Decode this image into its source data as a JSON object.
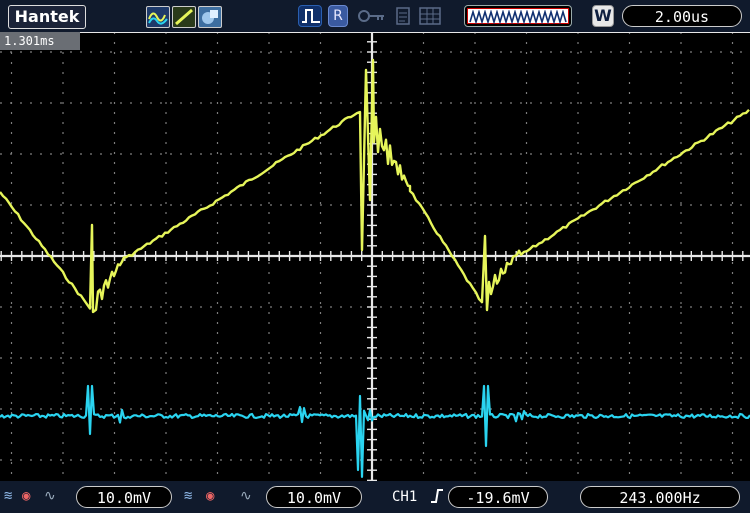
{
  "top_bar": {
    "brand": "Hantek",
    "trigger_mode_letter": "R",
    "timebase_mode_letter": "W",
    "timebase_value": "2.00us"
  },
  "time_readout": "1.301ms",
  "bottom_bar": {
    "ch1_scale": "10.0mV",
    "ch2_scale": "10.0mV",
    "trigger_source": "CH1",
    "trigger_level": "-19.6mV",
    "frequency": "243.000Hz"
  },
  "colors": {
    "ch1_trace": "#e6f55a",
    "ch2_trace": "#2ad4f0",
    "grid": "#7d7d7d",
    "center_axis": "#e8e8e8",
    "background": "#000000",
    "bar": "#101a2c"
  },
  "icons": [
    "wave-icon",
    "slope-icon",
    "blend-icon",
    "trigger-pulse-icon",
    "key-icon",
    "page-icon",
    "grid-icon",
    "waveform-memory-icon",
    "probe-icon",
    "coupling-icon",
    "rising-edge-icon"
  ]
}
